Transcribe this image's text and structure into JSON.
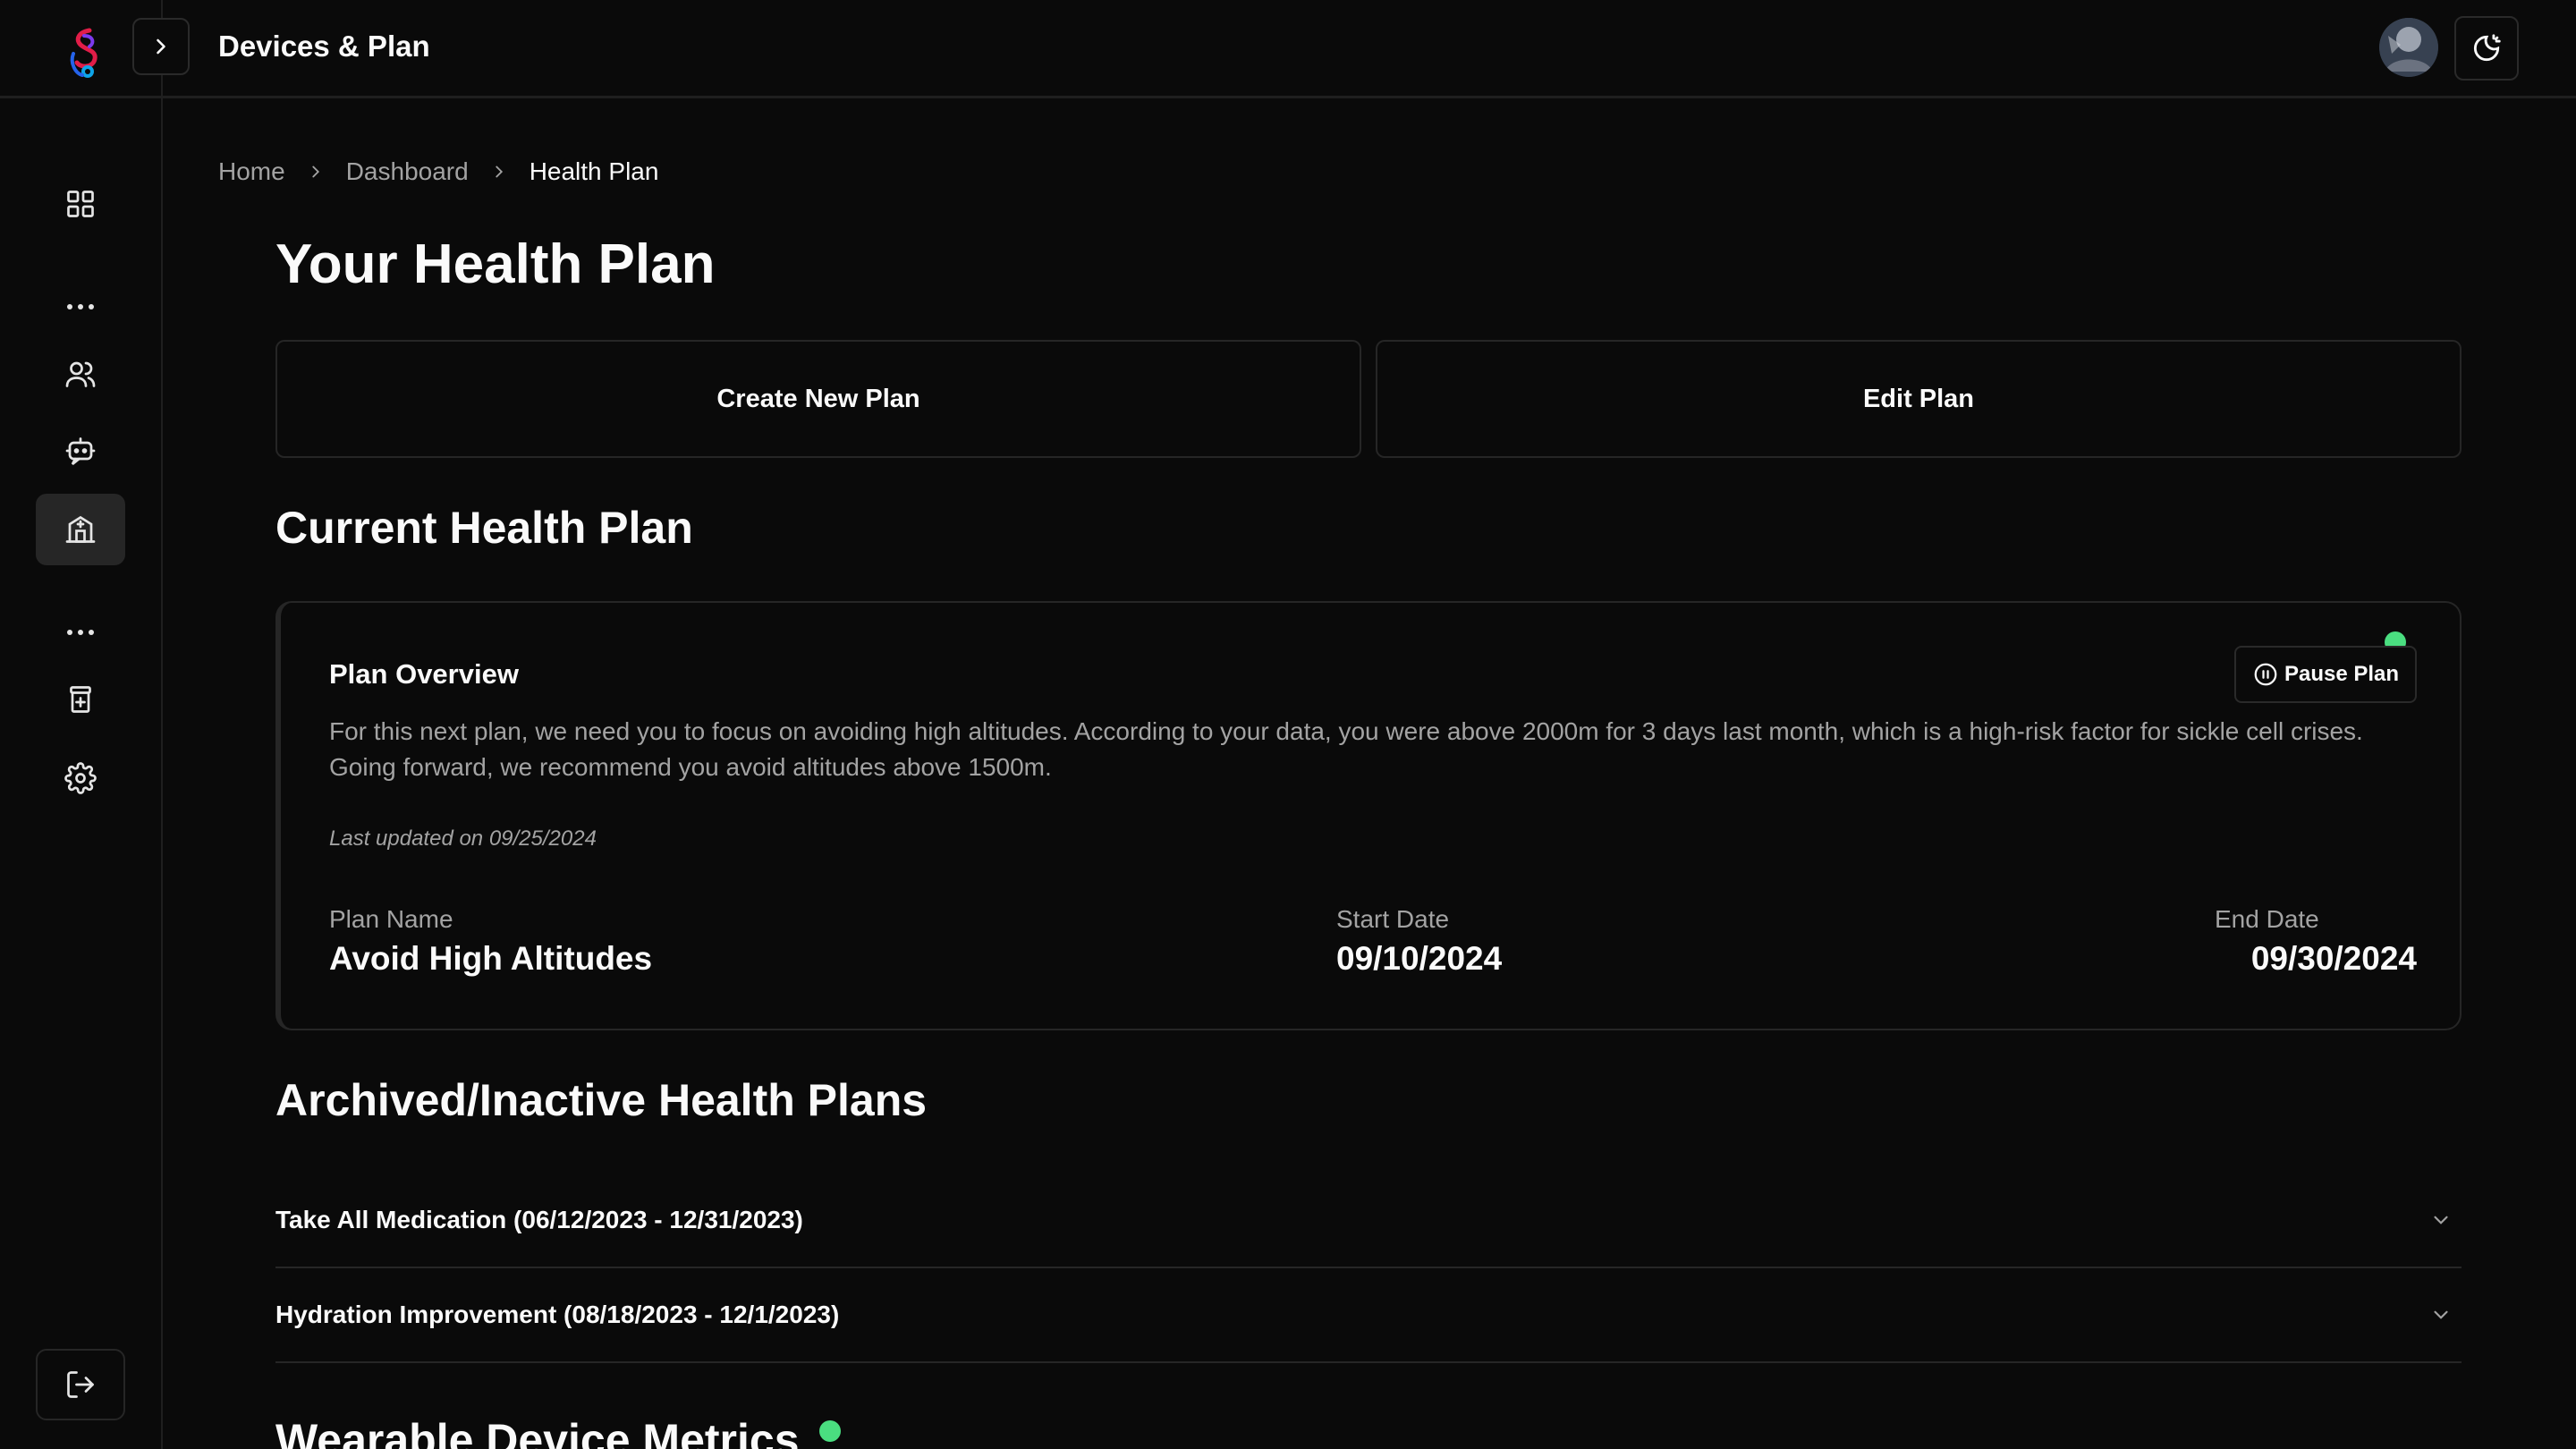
{
  "header": {
    "title": "Devices & Plan"
  },
  "breadcrumb": [
    "Home",
    "Dashboard",
    "Health Plan"
  ],
  "page": {
    "title": "Your Health Plan",
    "create_button": "Create New Plan",
    "edit_button": "Edit Plan"
  },
  "current_plan": {
    "section_title": "Current Health Plan",
    "card_title": "Plan Overview",
    "pause_label": "Pause Plan",
    "description": "For this next plan, we need you to focus on avoiding high altitudes. According to your data, you were above 2000m for 3 days last month, which is a high-risk factor for sickle cell crises. Going forward, we recommend you avoid altitudes above 1500m.",
    "last_updated": "Last updated on 09/25/2024",
    "plan_name_label": "Plan Name",
    "plan_name": "Avoid High Altitudes",
    "start_date_label": "Start Date",
    "start_date": "09/10/2024",
    "end_date_label": "End Date",
    "end_date": "09/30/2024",
    "status_color": "#4ade80"
  },
  "archived": {
    "section_title": "Archived/Inactive Health Plans",
    "items": [
      {
        "label": "Take All Medication (06/12/2023 - 12/31/2023)"
      },
      {
        "label": "Hydration Improvement (08/18/2023 - 12/1/2023)"
      }
    ]
  },
  "devices": {
    "section_title": "Wearable Device Metrics"
  },
  "sidebar": {
    "items": [
      {
        "icon": "dashboard-grid-icon"
      },
      {
        "icon": "users-icon"
      },
      {
        "icon": "chatbot-icon"
      },
      {
        "icon": "health-plan-icon",
        "active": true
      },
      {
        "icon": "medication-icon"
      },
      {
        "icon": "settings-gear-icon"
      }
    ],
    "logout_icon": "logout-icon"
  },
  "theme": {
    "background": "#0a0a0a",
    "accent_green": "#4ade80",
    "border": "#262626"
  }
}
